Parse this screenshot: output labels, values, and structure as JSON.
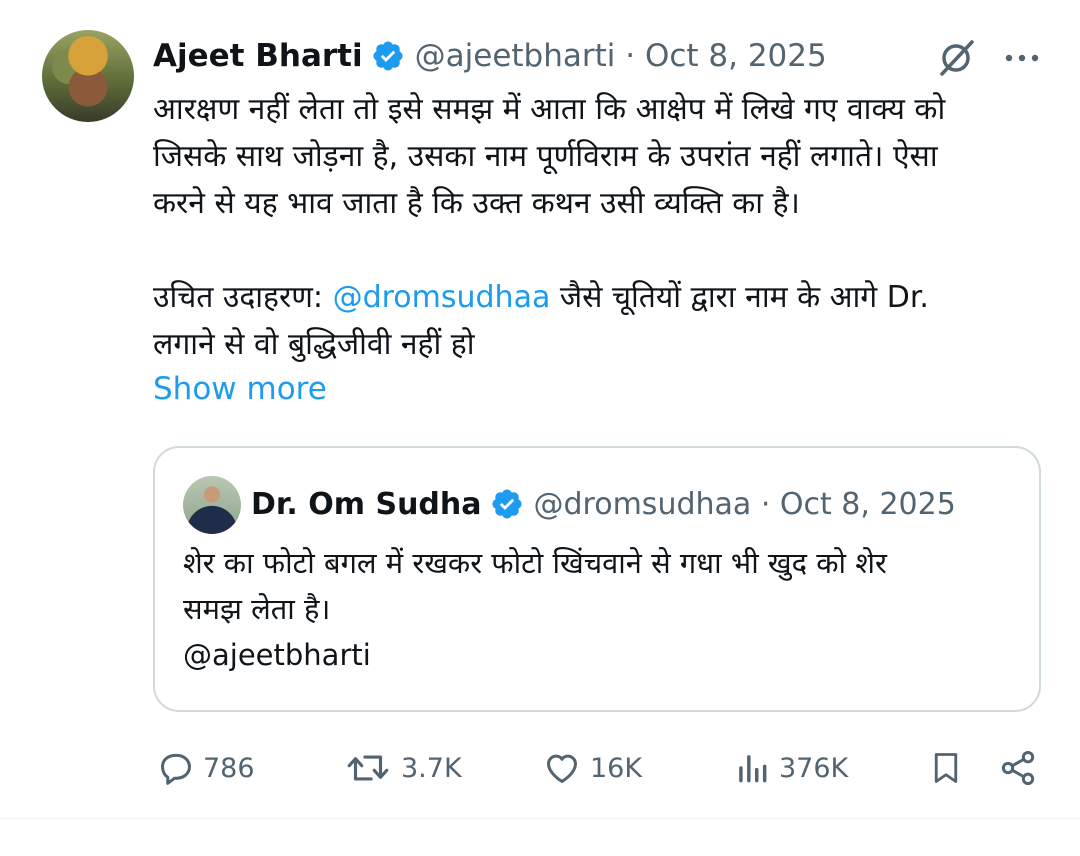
{
  "tweet": {
    "author_name": "Ajeet Bharti",
    "handle": "@ajeetbharti",
    "separator": " · ",
    "date": "Oct 8, 2025",
    "text_part1": "आरक्षण नहीं लेता तो इसे समझ में आता कि आक्षेप में लिखे गए वाक्य को\nजिसके साथ जोड़ना है, उसका नाम पूर्णविराम के उपरांत नहीं लगाते। ऐसा\nकरने से यह भाव जाता है कि उक्त कथन उसी व्यक्ति का है।\n\nउचित उदाहरण: ",
    "mention": "@dromsudhaa",
    "text_part2": " जैसे चूतियों द्वारा नाम के आगे Dr.\nलगाने से वो बुद्धिजीवी नहीं हो",
    "show_more": "Show more"
  },
  "quoted_tweet": {
    "author_name": "Dr. Om Sudha",
    "handle": "@dromsudhaa",
    "separator": " · ",
    "date": "Oct 8, 2025",
    "text": "शेर का फोटो बगल में रखकर फोटो खिंचवाने से गधा भी खुद को शेर\nसमझ लेता है।\n@ajeetbharti"
  },
  "actions": {
    "replies": "786",
    "reposts": "3.7K",
    "likes": "16K",
    "views": "376K"
  },
  "icons": {
    "verified": "verified-badge-icon",
    "grok": "grok-icon",
    "more": "more-icon",
    "reply": "reply-icon",
    "repost": "repost-icon",
    "like": "like-icon",
    "views": "views-icon",
    "bookmark": "bookmark-icon",
    "share": "share-icon"
  },
  "colors": {
    "accent": "#1d9bf0",
    "muted": "#536471",
    "text": "#0f1419",
    "border": "#cfd9de"
  }
}
